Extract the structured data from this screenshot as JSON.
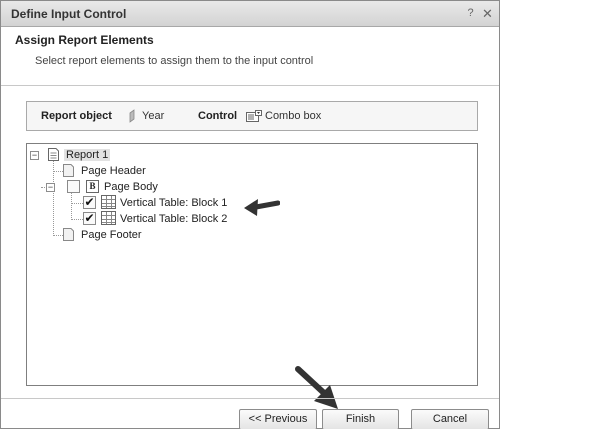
{
  "dialog": {
    "title": "Define Input Control",
    "help_glyph": "?",
    "close_glyph": "✕"
  },
  "header": {
    "title": "Assign Report Elements",
    "subtitle": "Select report elements to assign them to the input control"
  },
  "info": {
    "report_object_label": "Report object",
    "report_object_value": "Year",
    "control_label": "Control",
    "control_value": "Combo box"
  },
  "tree": {
    "root": "Report 1",
    "page_header": "Page Header",
    "page_body": "Page Body",
    "block1": "Vertical Table: Block 1",
    "block2": "Vertical Table: Block 2",
    "page_footer": "Page Footer",
    "collapse_glyph": "−",
    "check_glyph": "✔",
    "body_glyph": "B"
  },
  "buttons": {
    "previous": "<< Previous",
    "finish": "Finish",
    "cancel": "Cancel"
  },
  "colors": {
    "titlebar": "#dcdcdc",
    "selection": "#e2e2e2"
  }
}
